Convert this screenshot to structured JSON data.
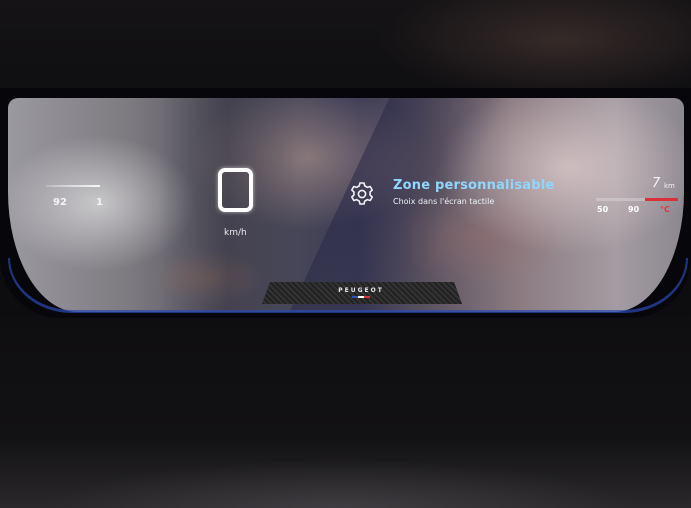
{
  "cluster": {
    "left_gauge": {
      "value_a": "92",
      "value_b": "1"
    },
    "speed": {
      "unit": "km/h"
    },
    "custom_zone": {
      "icon": "gear-icon",
      "title": "Zone personnalisable",
      "subtitle": "Choix dans l'écran tactile"
    },
    "right_gauge": {
      "range_value": "7",
      "range_unit": "km",
      "temp_ticks": [
        "50",
        "90"
      ],
      "temp_unit": "°C"
    },
    "brand": {
      "wordmark": "PEUGEOT"
    }
  },
  "colors": {
    "zone_title": "#8fd7ff",
    "accent_blue": "#2b4bb5",
    "temp_red": "#d8313a"
  }
}
